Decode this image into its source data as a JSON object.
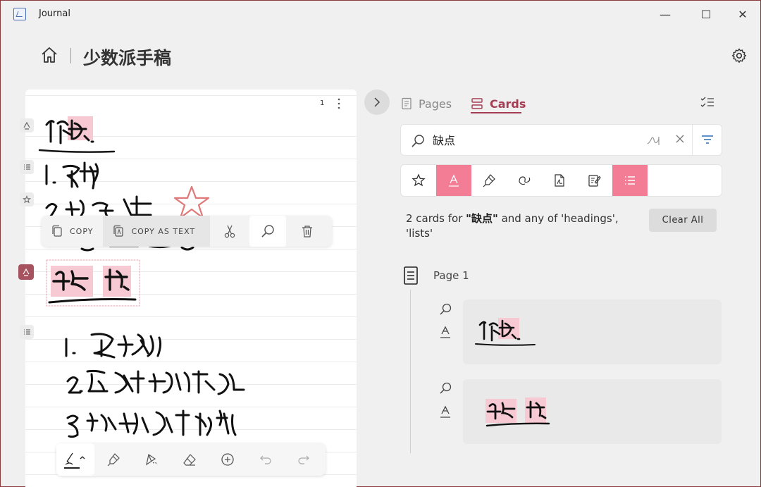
{
  "app": {
    "title": "Journal",
    "icon": "journal-app-icon"
  },
  "window_controls": {
    "minimize": "—",
    "maximize": "☐",
    "close": "✕"
  },
  "header": {
    "title": "少数派手稿",
    "home_icon": "home-icon",
    "settings_icon": "gear-icon"
  },
  "canvas": {
    "page_number": "1"
  },
  "selection_toolbar": {
    "copy_label": "COPY",
    "copy_as_text_label": "COPY AS TEXT"
  },
  "side_panel": {
    "tabs": [
      {
        "label": "Pages",
        "selected": false
      },
      {
        "label": "Cards",
        "selected": true
      }
    ],
    "search": {
      "value": "缺点",
      "placeholder": ""
    },
    "filters": [
      {
        "name": "favorites",
        "active": false
      },
      {
        "name": "headings",
        "active": true
      },
      {
        "name": "highlights",
        "active": false
      },
      {
        "name": "ink-drawings",
        "active": false
      },
      {
        "name": "documents",
        "active": false
      },
      {
        "name": "notes",
        "active": false
      },
      {
        "name": "lists",
        "active": true
      }
    ],
    "result": {
      "prefix": "2 cards for ",
      "query": "\"缺点\"",
      "suffix": " and any of 'headings', 'lists'"
    },
    "clear_all_label": "Clear All",
    "group": {
      "label": "Page 1"
    }
  },
  "colors": {
    "accent": "#a43d53",
    "filter_active": "#f37d95",
    "highlight": "#f7c9d3"
  }
}
